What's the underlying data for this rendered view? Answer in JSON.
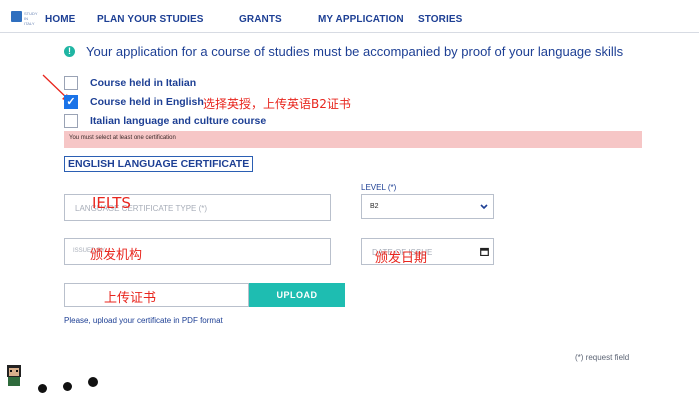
{
  "nav": {
    "logo_text": "STUDY IN ITALY",
    "home": "HOME",
    "plan": "PLAN YOUR STUDIES",
    "grants": "GRANTS",
    "application": "MY APPLICATION",
    "stories": "STORIES"
  },
  "info": {
    "icon": "!",
    "text": "Your application for a course of studies must be accompanied by proof of your language skills"
  },
  "options": [
    {
      "label": "Course held in Italian",
      "checked": false
    },
    {
      "label": "Course held in English",
      "checked": true
    },
    {
      "label": "Italian language and culture course",
      "checked": false
    }
  ],
  "annotations": {
    "choose_english": "选择英授，上传英语B2证书",
    "ielts": "IELTS",
    "issuer": "颁发机构",
    "issue_date": "颁发日期",
    "upload_cert": "上传证书"
  },
  "error_text": "You must select at least one certification",
  "section_title": "ENGLISH LANGUAGE CERTIFICATE",
  "form": {
    "cert_type_placeholder": "LANGUAGE CERTIFICATE TYPE (*)",
    "level_label": "LEVEL (*)",
    "level_value": "B2",
    "issuer_placeholder": "ISSUED BY",
    "date_placeholder": "DATE OF ISSUE"
  },
  "upload": {
    "button": "UPLOAD",
    "hint": "Please, upload your certificate in PDF format"
  },
  "required_note": "(*) request field",
  "colors": {
    "brand_blue": "#1d3f94",
    "teal": "#1ebdb1",
    "error_bg": "#f6c6c6",
    "annotation_red": "#e8261e",
    "checkbox_blue": "#1a73e8"
  }
}
